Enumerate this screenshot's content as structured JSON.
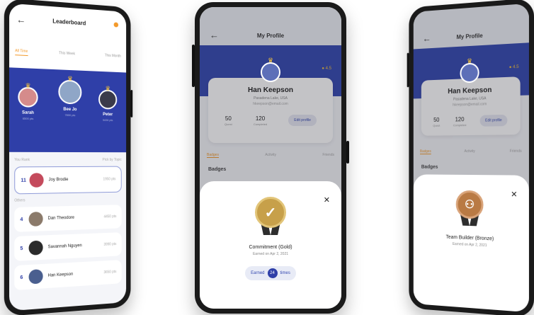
{
  "leaderboard": {
    "title": "Leaderboard",
    "tabs": [
      "All Time",
      "This Week",
      "This Month"
    ],
    "podium": [
      {
        "name": "Sarah",
        "points": "6500 pts"
      },
      {
        "name": "Bee Jo",
        "points": "7800 pts"
      },
      {
        "name": "Peter",
        "points": "5430 pts"
      }
    ],
    "list_meta_left": "You Rank",
    "list_meta_right": "Pick by Topic",
    "my_row": {
      "rank": "11",
      "name": "Joy Brodie",
      "points": "1950 pts"
    },
    "others_label": "Others",
    "rows": [
      {
        "rank": "4",
        "name": "Dan Theodore",
        "points": "4450 pts"
      },
      {
        "rank": "5",
        "name": "Savannah Nguyen",
        "points": "3990 pts"
      },
      {
        "rank": "6",
        "name": "Han Keepson",
        "points": "3650 pts"
      }
    ]
  },
  "profile": {
    "title": "My Profile",
    "name": "Han Keepson",
    "location": "Pasadena Lake, USA",
    "email": "hkeepson@email.com",
    "level": "4.5",
    "stats": [
      {
        "value": "50",
        "label": "Quest"
      },
      {
        "value": "120",
        "label": "Completed"
      }
    ],
    "edit_label": "Edit profile",
    "tabs": [
      "Badges",
      "Activity",
      "Friends"
    ],
    "badges_heading": "Badges"
  },
  "badge_gold": {
    "title": "Commitment (Gold)",
    "date": "Earned on Apr 2, 2021",
    "earned_prefix": "Earned",
    "earned_count": "24",
    "earned_suffix": "times"
  },
  "badge_bronze": {
    "title": "Team Builder (Bronze)",
    "date": "Earned on Apr 2, 2021"
  },
  "icons": {
    "back": "arrow-left-icon",
    "close": "close-icon",
    "crown": "crown-icon",
    "check": "check-icon",
    "team": "team-icon"
  },
  "colors": {
    "brand_blue": "#2f3fa8",
    "accent_orange": "#f39a2b",
    "gold": "#c7a04a",
    "bronze": "#b97a44"
  }
}
